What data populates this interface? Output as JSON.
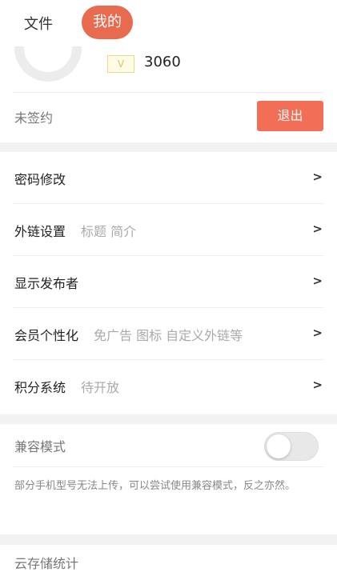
{
  "tabs": {
    "file": "文件",
    "mine": "我的"
  },
  "profile": {
    "vip_badge": "V",
    "points": "3060",
    "status": "未签约",
    "logout_label": "退出"
  },
  "menu": {
    "items": [
      {
        "title": "密码修改",
        "desc": "",
        "arrow": ">"
      },
      {
        "title": "外链设置",
        "desc": "标题 简介",
        "arrow": ">"
      },
      {
        "title": "显示发布者",
        "desc": "",
        "arrow": ">"
      },
      {
        "title": "会员个性化",
        "desc": "免广告 图标 自定义外链等",
        "arrow": ">"
      },
      {
        "title": "积分系统",
        "desc": "待开放",
        "arrow": ">"
      }
    ]
  },
  "compat": {
    "title": "兼容模式",
    "enabled": false,
    "note": "部分手机型号无法上传，可以尝试使用兼容模式，反之亦然。"
  },
  "storage": {
    "title": "云存储统计"
  },
  "colors": {
    "accent": "#e86a4f",
    "logout": "#f36e57",
    "background": "#f2f2f2"
  }
}
